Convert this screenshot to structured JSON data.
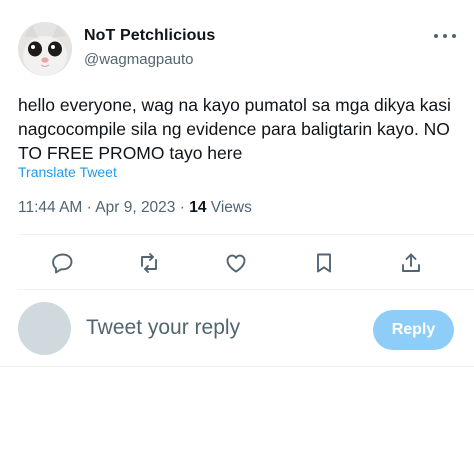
{
  "author": {
    "display_name": "NoT Petchlicious",
    "handle": "@wagmagpauto"
  },
  "tweet": {
    "text": "hello everyone, wag na kayo pumatol sa mga dikya kasi nagcocompile sila ng evidence para baligtarin kayo. NO TO FREE PROMO tayo here",
    "translate_label": "Translate Tweet",
    "time": "11:44 AM",
    "date": "Apr 9, 2023",
    "views_count": "14",
    "views_label": "Views"
  },
  "actions": {
    "icons": [
      "reply-icon",
      "retweet-icon",
      "like-icon",
      "bookmark-icon",
      "share-icon"
    ]
  },
  "reply": {
    "placeholder": "Tweet your reply",
    "button_label": "Reply"
  },
  "colors": {
    "link": "#1d9bf0",
    "secondary_text": "#536471",
    "reply_button": "#8ecdf8"
  }
}
